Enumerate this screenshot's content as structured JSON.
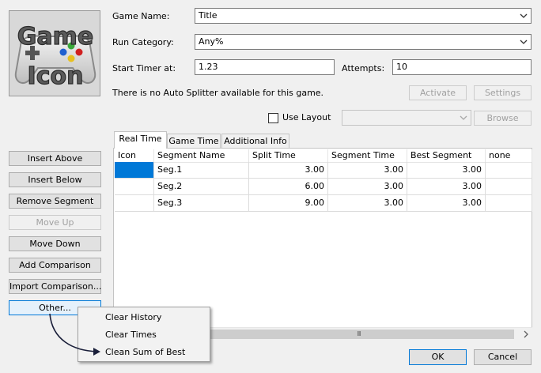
{
  "game_icon": {
    "line1": "Game",
    "line2": "Icon"
  },
  "game_name": {
    "label": "Game Name:",
    "value": "Title"
  },
  "run_category": {
    "label": "Run Category:",
    "value": "Any%"
  },
  "start_timer": {
    "label": "Start Timer at:",
    "value": "1.23"
  },
  "attempts": {
    "label": "Attempts:",
    "value": "10"
  },
  "auto_splitter": {
    "message": "There is no Auto Splitter available for this game.",
    "activate_label": "Activate",
    "settings_label": "Settings"
  },
  "layout": {
    "use_layout_label": "Use Layout",
    "use_layout_checked": false,
    "path_value": "",
    "browse_label": "Browse"
  },
  "tabs": [
    {
      "label": "Real Time",
      "active": true
    },
    {
      "label": "Game Time",
      "active": false
    },
    {
      "label": "Additional Info",
      "active": false
    }
  ],
  "grid": {
    "columns": [
      "Icon",
      "Segment Name",
      "Split Time",
      "Segment Time",
      "Best Segment",
      "none"
    ],
    "rows": [
      {
        "icon": "",
        "name": "Seg.1",
        "split": "3.00",
        "segment": "3.00",
        "best": "3.00",
        "none": ""
      },
      {
        "icon": "",
        "name": "Seg.2",
        "split": "6.00",
        "segment": "3.00",
        "best": "3.00",
        "none": ""
      },
      {
        "icon": "",
        "name": "Seg.3",
        "split": "9.00",
        "segment": "3.00",
        "best": "3.00",
        "none": ""
      }
    ],
    "selected_row": 0
  },
  "side_buttons": {
    "insert_above": "Insert Above",
    "insert_below": "Insert Below",
    "remove_segment": "Remove Segment",
    "move_up": "Move Up",
    "move_down": "Move Down",
    "add_comparison": "Add Comparison",
    "import_comparison": "Import Comparison...",
    "other": "Other..."
  },
  "other_menu": {
    "items": [
      "Clear History",
      "Clear Times",
      "Clean Sum of Best"
    ]
  },
  "scrollbar": {
    "grip": "III"
  },
  "footer": {
    "ok_label": "OK",
    "cancel_label": "Cancel"
  },
  "colors": {
    "selection": "#0078d7",
    "window_bg": "#f0f0f0",
    "button_bg": "#e1e1e1",
    "icon_green": "#3aa83a",
    "icon_yellow": "#e8c020",
    "icon_red": "#d02020",
    "icon_blue": "#2060d0"
  }
}
